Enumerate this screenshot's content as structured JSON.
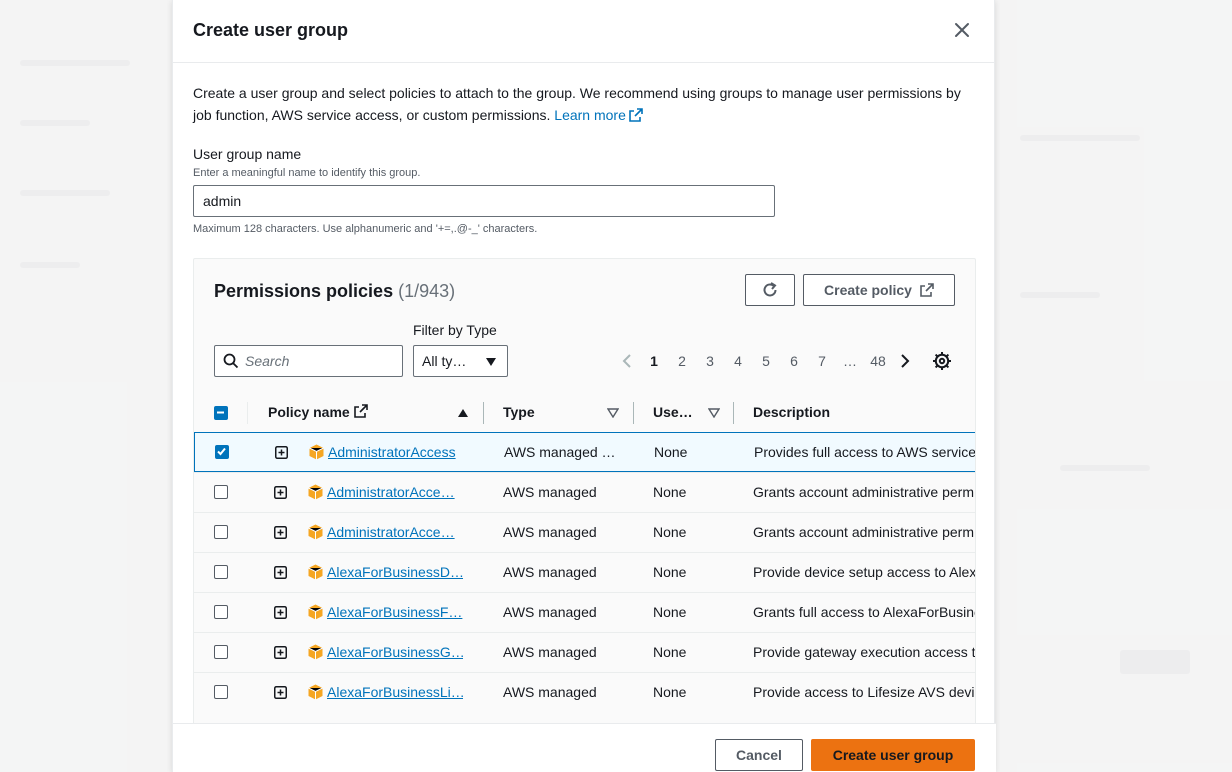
{
  "colors": {
    "primary_button": "#ec7211",
    "link": "#0073bb",
    "selected_row_bg": "#f1faff",
    "checkbox_checked": "#0073bb",
    "policy_icon": "#f5a623"
  },
  "modal": {
    "title": "Create user group",
    "intro_text": "Create a user group and select policies to attach to the group. We recommend using groups to manage user permissions by job function, AWS service access, or custom permissions.",
    "learn_more": "Learn more",
    "user_group_name": {
      "label": "User group name",
      "description": "Enter a meaningful name to identify this group.",
      "value": "admin",
      "constraint": "Maximum 128 characters. Use alphanumeric and '+=,.@-_' characters."
    }
  },
  "policies": {
    "title": "Permissions policies",
    "count": "(1/943)",
    "create_policy_label": "Create policy",
    "filter_label": "Filter by Type",
    "search_placeholder": "Search",
    "filter_value": "All ty…",
    "pagination": {
      "pages": [
        "1",
        "2",
        "3",
        "4",
        "5",
        "6",
        "7",
        "…",
        "48"
      ],
      "current": "1"
    },
    "columns": {
      "policy_name": "Policy name",
      "type": "Type",
      "used_as": "Use…",
      "description": "Description"
    },
    "rows": [
      {
        "name": "AdministratorAccess",
        "type": "AWS managed …",
        "used_as": "None",
        "description": "Provides full access to AWS services",
        "checked": true
      },
      {
        "name": "AdministratorAcce…",
        "type": "AWS managed",
        "used_as": "None",
        "description": "Grants account administrative perm",
        "checked": false
      },
      {
        "name": "AdministratorAcce…",
        "type": "AWS managed",
        "used_as": "None",
        "description": "Grants account administrative perm",
        "checked": false
      },
      {
        "name": "AlexaForBusinessD…",
        "type": "AWS managed",
        "used_as": "None",
        "description": "Provide device setup access to Alex",
        "checked": false
      },
      {
        "name": "AlexaForBusinessF…",
        "type": "AWS managed",
        "used_as": "None",
        "description": "Grants full access to AlexaForBusine",
        "checked": false
      },
      {
        "name": "AlexaForBusinessG…",
        "type": "AWS managed",
        "used_as": "None",
        "description": "Provide gateway execution access t",
        "checked": false
      },
      {
        "name": "AlexaForBusinessLi…",
        "type": "AWS managed",
        "used_as": "None",
        "description": "Provide access to Lifesize AVS devic",
        "checked": false
      }
    ]
  },
  "footer": {
    "cancel_label": "Cancel",
    "create_label": "Create user group"
  }
}
